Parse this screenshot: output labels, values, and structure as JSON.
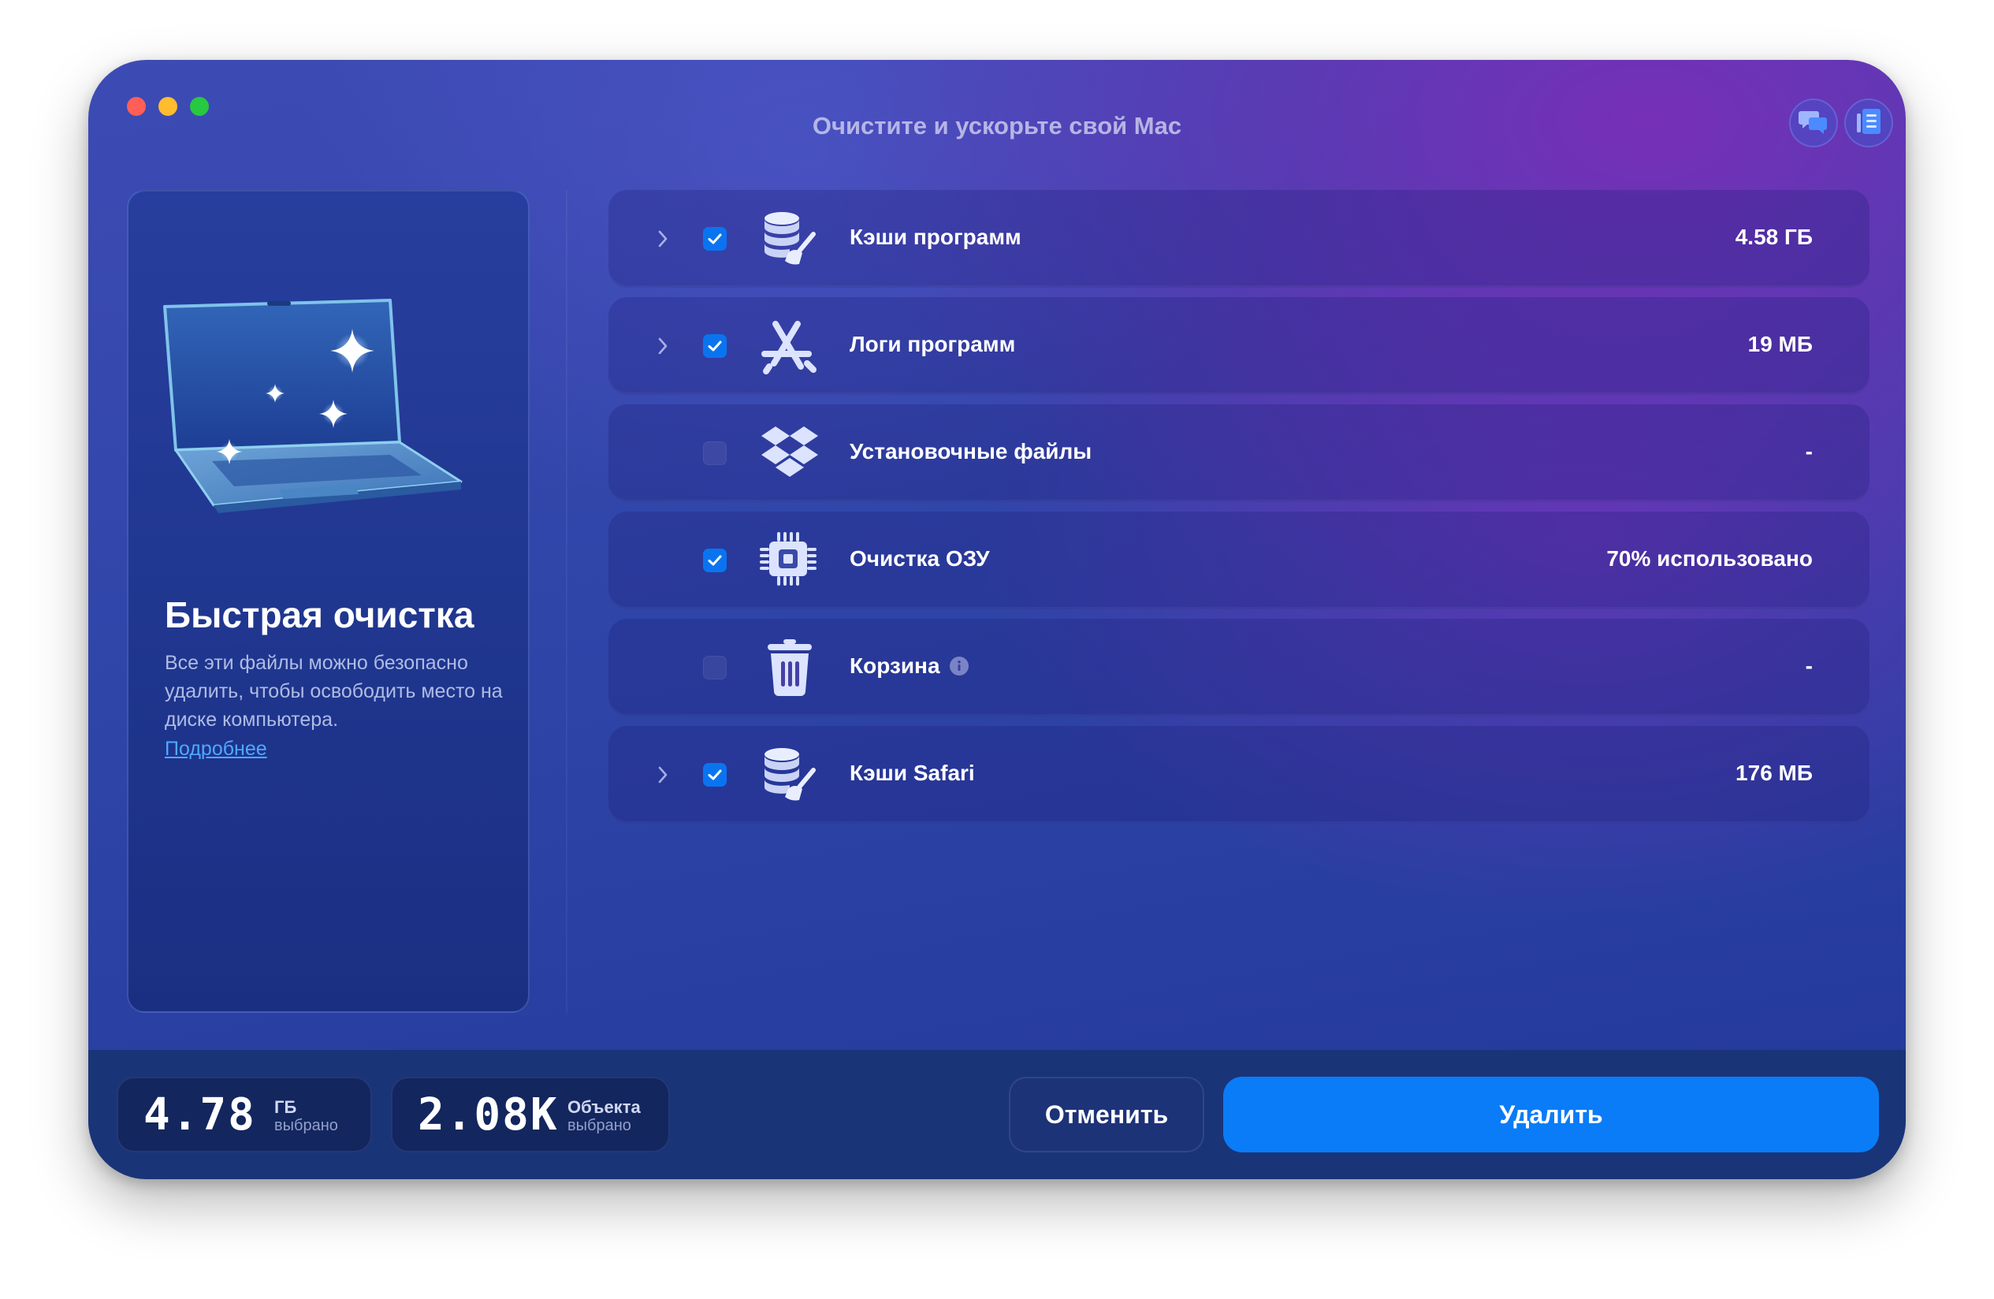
{
  "window": {
    "title": "Очистите и ускорьте свой Mac"
  },
  "toolbar": {
    "chat_icon": "chat-bubbles-icon",
    "list_icon": "list-document-icon"
  },
  "sidebar": {
    "title": "Быстрая очистка",
    "description": "Все эти файлы можно безопасно удалить, чтобы освободить место на диске компьютера.",
    "link": "Подробнее",
    "illustration": "laptop-sparkles"
  },
  "items": [
    {
      "label": "Кэши программ",
      "value": "4.58 ГБ",
      "checked": true,
      "expandable": true,
      "icon": "database-broom-icon"
    },
    {
      "label": "Логи программ",
      "value": "19 МБ",
      "checked": true,
      "expandable": true,
      "icon": "app-store-icon"
    },
    {
      "label": "Установочные файлы",
      "value": "-",
      "checked": false,
      "expandable": false,
      "icon": "dropbox-box-icon"
    },
    {
      "label": "Очистка ОЗУ",
      "value": "70% использовано",
      "checked": true,
      "expandable": false,
      "icon": "chip-icon"
    },
    {
      "label": "Корзина",
      "value": "-",
      "checked": false,
      "expandable": false,
      "icon": "trash-icon",
      "info": true
    },
    {
      "label": "Кэши Safari",
      "value": "176 МБ",
      "checked": true,
      "expandable": true,
      "icon": "database-broom-icon"
    }
  ],
  "footer": {
    "size": {
      "number": "4.78",
      "unit": "ГБ",
      "sub": "выбрано"
    },
    "count": {
      "number": "2.08K",
      "unit": "Объекта",
      "sub": "выбрано"
    },
    "cancel_label": "Отменить",
    "delete_label": "Удалить"
  },
  "colors": {
    "accent": "#0a7cf8",
    "checkbox": "#0a74f0",
    "link": "#4fa8ff"
  }
}
